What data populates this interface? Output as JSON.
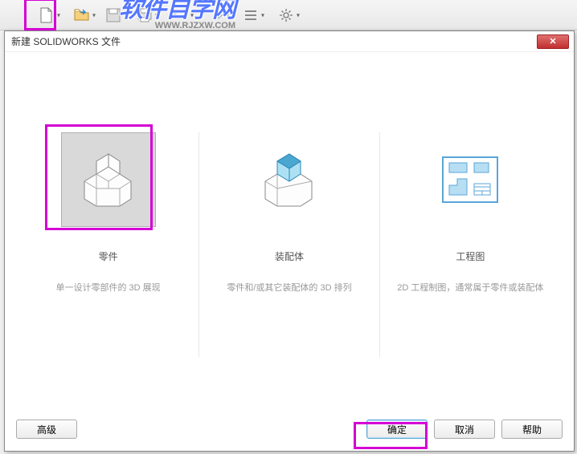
{
  "watermark": {
    "main": "软件自学网",
    "sub": "WWW.RJZXW.COM"
  },
  "toolbar": {
    "icons": {
      "new": "new-file-icon",
      "open": "open-file-icon",
      "save": "save-icon",
      "print": "print-icon",
      "undo": "undo-icon",
      "redo": "redo-icon",
      "list": "list-icon",
      "gear": "gear-icon"
    }
  },
  "dialog": {
    "title": "新建 SOLIDWORKS 文件",
    "close": "✕",
    "options": [
      {
        "key": "part",
        "title": "零件",
        "desc": "单一设计零部件的 3D 展现",
        "selected": true
      },
      {
        "key": "assembly",
        "title": "装配体",
        "desc": "零件和/或其它装配体的 3D 排列",
        "selected": false
      },
      {
        "key": "drawing",
        "title": "工程图",
        "desc": "2D 工程制图，通常属于零件或装配体",
        "selected": false
      }
    ],
    "buttons": {
      "advanced": "高级",
      "ok": "确定",
      "cancel": "取消",
      "help": "帮助"
    }
  }
}
